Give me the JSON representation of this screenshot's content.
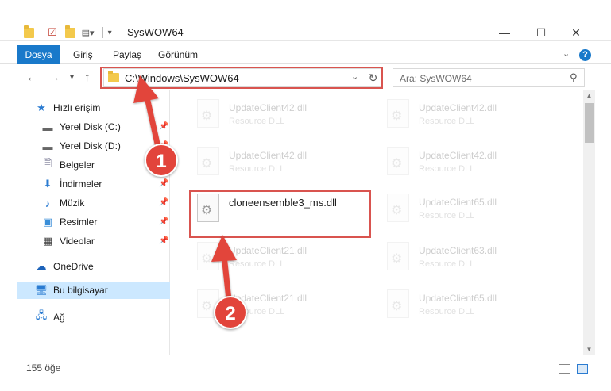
{
  "window": {
    "title": "SysWOW64",
    "minimize": "—",
    "maximize": "☐",
    "close": "✕"
  },
  "ribbon": {
    "tabs": [
      "Dosya",
      "Giriş",
      "Paylaş",
      "Görünüm"
    ],
    "help": "?"
  },
  "address": {
    "path": "C:\\Windows\\SysWOW64",
    "search_placeholder": "Ara: SysWOW64"
  },
  "sidebar": {
    "items": [
      {
        "label": "Hızlı erişim",
        "icon": "star-icon",
        "pinned": false
      },
      {
        "label": "Yerel Disk (C:)",
        "icon": "drive-icon",
        "pinned": true
      },
      {
        "label": "Yerel Disk (D:)",
        "icon": "drive-icon",
        "pinned": true
      },
      {
        "label": "Belgeler",
        "icon": "document-icon",
        "pinned": true
      },
      {
        "label": "İndirmeler",
        "icon": "download-icon",
        "pinned": true
      },
      {
        "label": "Müzik",
        "icon": "music-icon",
        "pinned": true
      },
      {
        "label": "Resimler",
        "icon": "pictures-icon",
        "pinned": true
      },
      {
        "label": "Videolar",
        "icon": "video-icon",
        "pinned": true
      },
      {
        "label": "OneDrive",
        "icon": "cloud-icon",
        "pinned": false
      },
      {
        "label": "Bu bilgisayar",
        "icon": "computer-icon",
        "pinned": false
      },
      {
        "label": "Ağ",
        "icon": "network-icon",
        "pinned": false
      }
    ]
  },
  "files": [
    {
      "name": "UpdateClient42.dll",
      "type": "Resource DLL",
      "faded": true
    },
    {
      "name": "UpdateClient42.dll",
      "type": "Resource DLL",
      "faded": true
    },
    {
      "name": "UpdateClient42.dll",
      "type": "Resource DLL",
      "faded": true
    },
    {
      "name": "UpdateClient42.dll",
      "type": "Resource DLL",
      "faded": true
    },
    {
      "name": "cloneensemble3_ms.dll",
      "type": "",
      "faded": false
    },
    {
      "name": "UpdateClient65.dll",
      "type": "Resource DLL",
      "faded": true
    },
    {
      "name": "UpdateClient21.dll",
      "type": "Resource DLL",
      "faded": true
    },
    {
      "name": "UpdateClient63.dll",
      "type": "Resource DLL",
      "faded": true
    },
    {
      "name": "UpdateClient21.dll",
      "type": "Resource DLL",
      "faded": true
    },
    {
      "name": "UpdateClient65.dll",
      "type": "Resource DLL",
      "faded": true
    }
  ],
  "status": {
    "item_count": "155 öğe"
  },
  "annotations": {
    "step1": "1",
    "step2": "2",
    "color": "#e2443b"
  }
}
